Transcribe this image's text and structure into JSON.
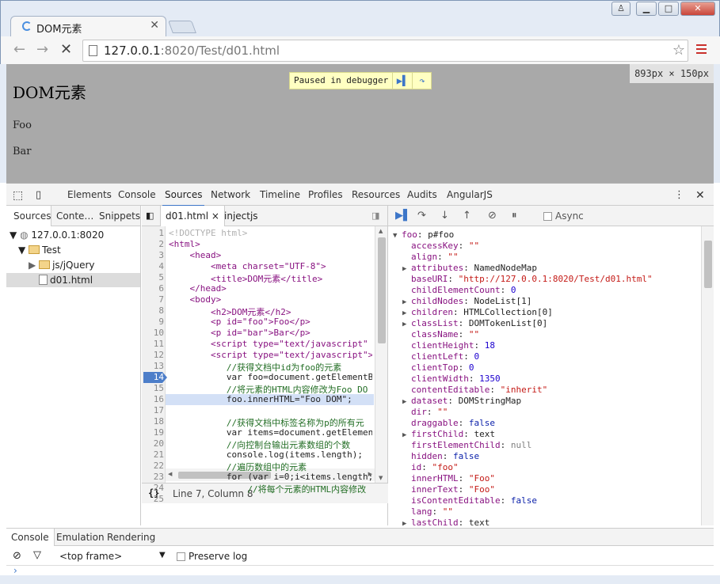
{
  "browser": {
    "tab_title": "DOM元素",
    "url_host": "127.0.0.1",
    "url_rest": ":8020/Test/d01.html",
    "win_min": "▁",
    "win_max": "□",
    "win_close": "✕",
    "back": "←",
    "forward": "→",
    "stop": "✕",
    "star": "☆",
    "win_user": "♙"
  },
  "page": {
    "heading": "DOM元素",
    "p1": "Foo",
    "p2": "Bar",
    "paused_label": "Paused in debugger",
    "dimensions": "893px × 150px"
  },
  "devtools": {
    "tabs": [
      "Elements",
      "Console",
      "Sources",
      "Network",
      "Timeline",
      "Profiles",
      "Resources",
      "Audits",
      "AngularJS"
    ],
    "nav_tabs": [
      "Sources",
      "Conte…",
      "Snippets"
    ],
    "tree": [
      {
        "label": "127.0.0.1:8020",
        "arrow": "▼"
      },
      {
        "label": "Test",
        "arrow": "▼"
      },
      {
        "label": "js/jQuery",
        "arrow": "▶"
      },
      {
        "label": "d01.html",
        "arrow": ""
      }
    ],
    "editor_tabs": [
      "d01.html",
      "injectjs"
    ],
    "editor_tab1": "injectjs",
    "editor_tab0_close": "×",
    "status": "Line 7, Column 8",
    "status_icon": "{}",
    "async_label": "Async",
    "line_numbers": [
      "1",
      "2",
      "3",
      "4",
      "5",
      "6",
      "7",
      "8",
      "9",
      "10",
      "11",
      "12",
      "13",
      "14",
      "15",
      "16",
      "17",
      "18",
      "19",
      "20",
      "21",
      "22",
      "23",
      "24",
      "25"
    ],
    "code": [
      "<!DOCTYPE html>",
      "<html>",
      "    <head>",
      "        <meta charset=\"UTF-8\">",
      "        <title>DOM元素</title>",
      "    </head>",
      "    <body>",
      "        <h2>DOM元素</h2>",
      "        <p id=\"foo\">Foo</p>",
      "        <p id=\"bar\">Bar</p>",
      "        <script type=\"text/javascript\" s",
      "        <script type=\"text/javascript\">",
      "           //获得文档中id为foo的元素",
      "           var foo=document.getElementBy",
      "           //将元素的HTML内容修改为Foo DO",
      "           foo.innerHTML=\"Foo DOM\";",
      "",
      "           //获得文档中标签名称为p的所有元",
      "           var items=document.getElement",
      "           //向控制台输出元素数组的个数",
      "           console.log(items.length);",
      "           //遍历数组中的元素",
      "           for (var i=0;i<items.length;",
      "               //将每个元素的HTML内容修改",
      ""
    ],
    "scope": [
      {
        "t": "▼",
        "k": "foo",
        "v": "p#foo",
        "vt": "o"
      },
      {
        "t": "",
        "k": "accessKey",
        "v": "\"\"",
        "vt": "s"
      },
      {
        "t": "",
        "k": "align",
        "v": "\"\"",
        "vt": "s"
      },
      {
        "t": "▶",
        "k": "attributes",
        "v": "NamedNodeMap",
        "vt": "o"
      },
      {
        "t": "",
        "k": "baseURI",
        "v": "\"http://127.0.0.1:8020/Test/d01.html\"",
        "vt": "s"
      },
      {
        "t": "",
        "k": "childElementCount",
        "v": "0",
        "vt": "n"
      },
      {
        "t": "▶",
        "k": "childNodes",
        "v": "NodeList[1]",
        "vt": "o"
      },
      {
        "t": "▶",
        "k": "children",
        "v": "HTMLCollection[0]",
        "vt": "o"
      },
      {
        "t": "▶",
        "k": "classList",
        "v": "DOMTokenList[0]",
        "vt": "o"
      },
      {
        "t": "",
        "k": "className",
        "v": "\"\"",
        "vt": "s"
      },
      {
        "t": "",
        "k": "clientHeight",
        "v": "18",
        "vt": "n"
      },
      {
        "t": "",
        "k": "clientLeft",
        "v": "0",
        "vt": "n"
      },
      {
        "t": "",
        "k": "clientTop",
        "v": "0",
        "vt": "n"
      },
      {
        "t": "",
        "k": "clientWidth",
        "v": "1350",
        "vt": "n"
      },
      {
        "t": "",
        "k": "contentEditable",
        "v": "\"inherit\"",
        "vt": "s"
      },
      {
        "t": "▶",
        "k": "dataset",
        "v": "DOMStringMap",
        "vt": "o"
      },
      {
        "t": "",
        "k": "dir",
        "v": "\"\"",
        "vt": "s"
      },
      {
        "t": "",
        "k": "draggable",
        "v": "false",
        "vt": "b"
      },
      {
        "t": "▶",
        "k": "firstChild",
        "v": "text",
        "vt": "o"
      },
      {
        "t": "",
        "k": "firstElementChild",
        "v": "null",
        "vt": "null"
      },
      {
        "t": "",
        "k": "hidden",
        "v": "false",
        "vt": "b"
      },
      {
        "t": "",
        "k": "id",
        "v": "\"foo\"",
        "vt": "s"
      },
      {
        "t": "",
        "k": "innerHTML",
        "v": "\"Foo\"",
        "vt": "s"
      },
      {
        "t": "",
        "k": "innerText",
        "v": "\"Foo\"",
        "vt": "s"
      },
      {
        "t": "",
        "k": "isContentEditable",
        "v": "false",
        "vt": "b"
      },
      {
        "t": "",
        "k": "lang",
        "v": "\"\"",
        "vt": "s"
      },
      {
        "t": "▶",
        "k": "lastChild",
        "v": "text",
        "vt": "o"
      }
    ]
  },
  "drawer": {
    "tabs": [
      "Console",
      "Emulation",
      "Rendering"
    ],
    "frame": "<top frame>",
    "preserve_log": "Preserve log",
    "prompt": "›"
  },
  "colors": {
    "accent": "#3d76c8",
    "breakpoint": "#4d7ec9",
    "page_bg": "#a9a9a9"
  }
}
